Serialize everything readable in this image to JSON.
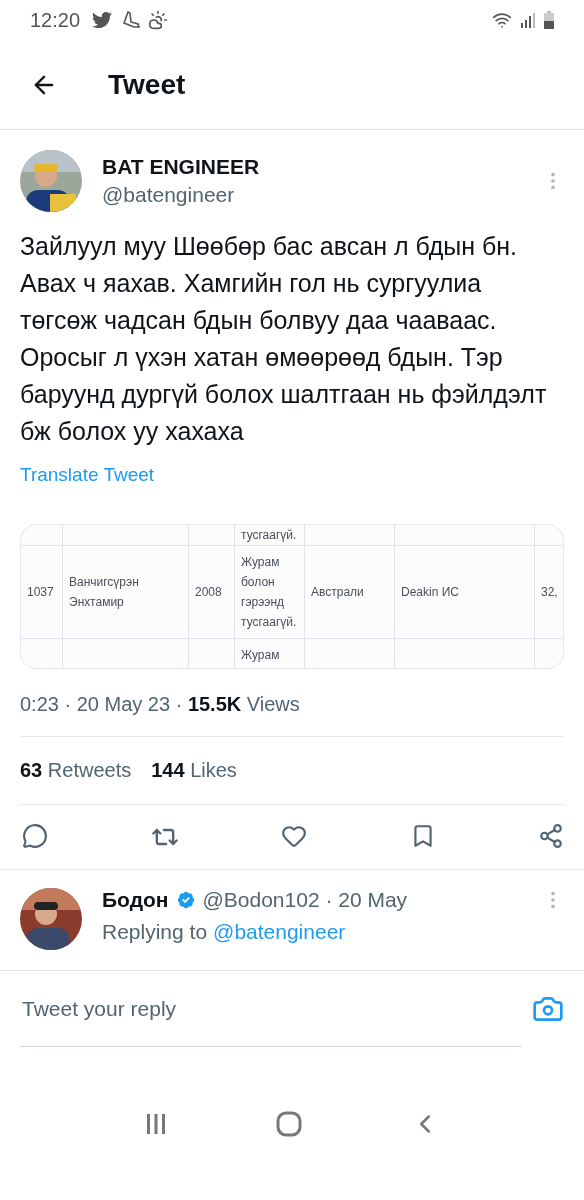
{
  "status_bar": {
    "time": "12:20"
  },
  "header": {
    "title": "Tweet"
  },
  "tweet": {
    "author": {
      "name": "BAT ENGINEER",
      "handle": "@batengineer"
    },
    "text": "Зайлуул муу Шөөбөр бас авсан л бдын бн. Авах ч яахав. Хамгийн гол нь сургуулиа төгсөж чадсан бдын болвуу даа чааваас. Оросыг л үхэн хатан өмөөрөөд бдын. Тэр баруунд дургүй болох шалтгаан нь фэйлдэлт бж болох уу хахаха",
    "translate": "Translate Tweet",
    "media": {
      "kind": "table",
      "rows": [
        {
          "column_4": "тусгаагүй."
        },
        {
          "column_1": "1037",
          "column_2": "Ванчигсүрэн Энхтамир",
          "column_3": "2008",
          "column_4": "Журам болон гэрээнд тусгаагүй.",
          "column_5": "Австрали",
          "column_6": "Deakin ИС",
          "column_7": "32,"
        },
        {
          "column_4": "Журам"
        }
      ]
    },
    "meta": "0:23 · 20 May 23 · **15.5K** Views",
    "stats": [
      {
        "count": "63",
        "label": "Retweets"
      },
      {
        "count": "144",
        "label": "Likes"
      }
    ],
    "actions": [
      {
        "kind": "reply"
      },
      {
        "kind": "retweet"
      },
      {
        "kind": "like"
      },
      {
        "kind": "bookmark"
      },
      {
        "kind": "share"
      }
    ]
  },
  "reply": {
    "name": "Бодон",
    "verified": true,
    "handle_date": "@Bodon102 · 20 May",
    "replying_label": "Replying to",
    "replying_to": "@batengineer"
  },
  "composer": {
    "placeholder": "Tweet your reply"
  }
}
